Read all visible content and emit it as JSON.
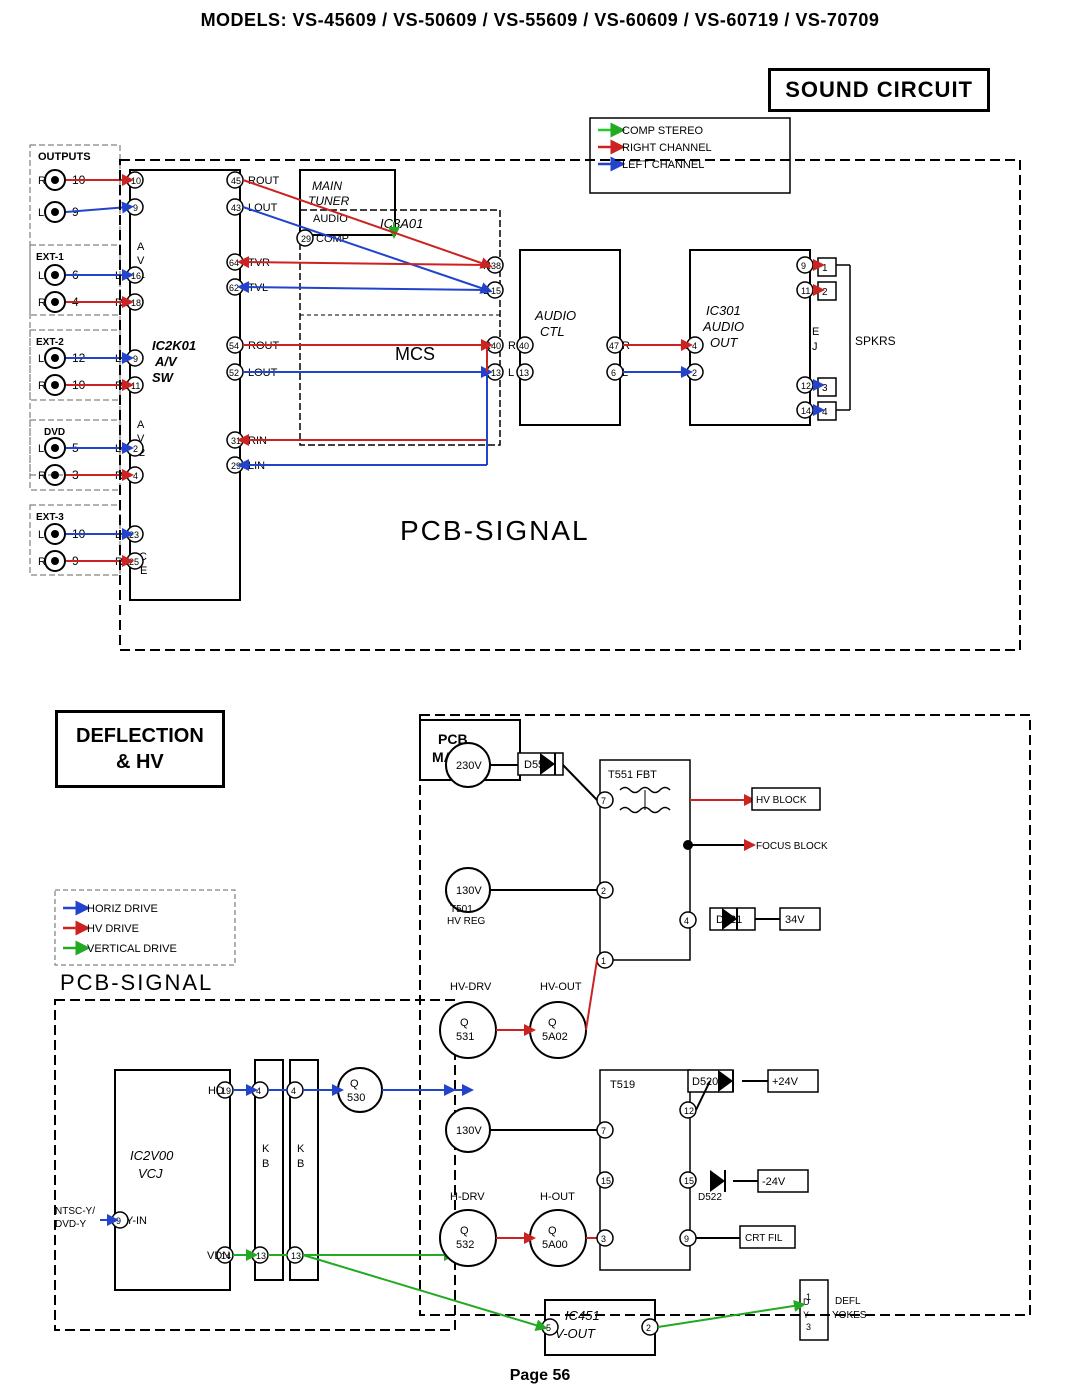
{
  "header": {
    "title": "MODELS: VS-45609 / VS-50609 / VS-55609 / VS-60609 / VS-60719 / VS-70709"
  },
  "sound_circuit": {
    "label": "SOUND CIRCUIT"
  },
  "deflection": {
    "label": "DEFLECTION\n& HV"
  },
  "legend_sound": {
    "comp_stereo": "COMP STEREO",
    "right_channel": "RIGHT CHANNEL",
    "left_channel": "LEFT CHANNEL"
  },
  "legend_deflection": {
    "horiz_drive": "HORIZ DRIVE",
    "hv_drive": "HV DRIVE",
    "vertical_drive": "VERTICAL DRIVE"
  },
  "page": "Page 56"
}
